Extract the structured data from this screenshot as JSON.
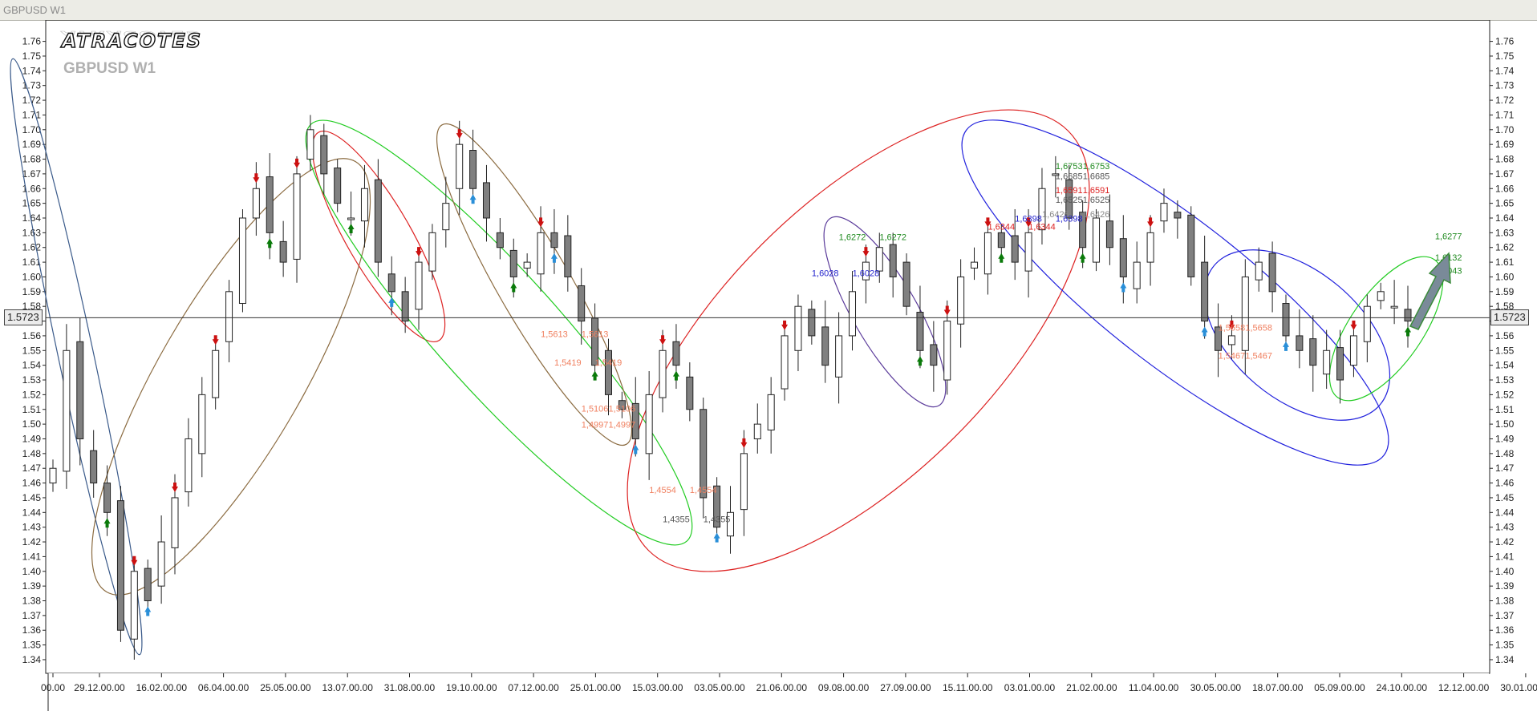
{
  "window": {
    "title": "GBPUSD W1"
  },
  "logo": {
    "text": "ATRACOTES"
  },
  "symbol_label": "GBPUSD W1",
  "current_price": "1.5723",
  "colors": {
    "bull_candle": "#ffffff",
    "bear_candle": "#808080",
    "up_arrow": "#2a8fd8",
    "down_arrow": "#cc1111",
    "green_ellipse": "#22cc22",
    "red_ellipse": "#dd2222",
    "blue_ellipse": "#2222dd",
    "brown_ellipse": "#8b6b40"
  },
  "chart_data": {
    "type": "candlestick",
    "ylim": [
      1.33,
      1.77
    ],
    "y_ticks": [
      "1.76",
      "1.75",
      "1.74",
      "1.73",
      "1.72",
      "1.71",
      "1.70",
      "1.69",
      "1.68",
      "1.67",
      "1.66",
      "1.65",
      "1.64",
      "1.63",
      "1.62",
      "1.61",
      "1.60",
      "1.59",
      "1.58",
      "1.57",
      "1.56",
      "1.55",
      "1.54",
      "1.53",
      "1.52",
      "1.51",
      "1.50",
      "1.49",
      "1.48",
      "1.47",
      "1.46",
      "1.45",
      "1.44",
      "1.43",
      "1.42",
      "1.41",
      "1.40",
      "1.39",
      "1.38",
      "1.37",
      "1.36",
      "1.35",
      "1.34"
    ],
    "x_ticks": [
      "00.00",
      "29.12.00.00",
      "16.02.00.00",
      "06.04.00.00",
      "25.05.00.00",
      "13.07.00.00",
      "31.08.00.00",
      "19.10.00.00",
      "07.12.00.00",
      "25.01.00.00",
      "15.03.00.00",
      "03.05.00.00",
      "21.06.00.00",
      "09.08.00.00",
      "27.09.00.00",
      "15.11.00.00",
      "03.01.00.00",
      "21.02.00.00",
      "11.04.00.00",
      "30.05.00.00",
      "18.07.00.00",
      "05.09.00.00",
      "24.10.00.00",
      "12.12.00.00",
      "30.01.00.00"
    ],
    "grid": false,
    "current_price": 1.5723,
    "path": [
      1.47,
      1.55,
      1.49,
      1.46,
      1.44,
      1.36,
      1.4,
      1.38,
      1.42,
      1.45,
      1.49,
      1.52,
      1.55,
      1.59,
      1.64,
      1.66,
      1.63,
      1.61,
      1.67,
      1.7,
      1.67,
      1.65,
      1.64,
      1.66,
      1.61,
      1.59,
      1.57,
      1.61,
      1.63,
      1.65,
      1.69,
      1.66,
      1.64,
      1.62,
      1.6,
      1.61,
      1.63,
      1.62,
      1.6,
      1.57,
      1.54,
      1.52,
      1.51,
      1.49,
      1.52,
      1.55,
      1.54,
      1.51,
      1.45,
      1.43,
      1.44,
      1.48,
      1.5,
      1.52,
      1.56,
      1.58,
      1.56,
      1.54,
      1.56,
      1.59,
      1.61,
      1.62,
      1.6,
      1.58,
      1.55,
      1.54,
      1.57,
      1.6,
      1.61,
      1.63,
      1.62,
      1.61,
      1.63,
      1.66,
      1.67,
      1.64,
      1.62,
      1.64,
      1.62,
      1.6,
      1.61,
      1.63,
      1.65,
      1.64,
      1.6,
      1.57,
      1.55,
      1.56,
      1.6,
      1.61,
      1.59,
      1.56,
      1.55,
      1.54,
      1.55,
      1.53,
      1.56,
      1.58,
      1.59,
      1.58,
      1.57
    ],
    "labels": [
      {
        "text": "1,6753",
        "x_idx": 75,
        "price": 1.6753,
        "color": "#1f8a1f"
      },
      {
        "text": "1,6753",
        "x_idx": 77,
        "price": 1.6753,
        "color": "#1f8a1f"
      },
      {
        "text": "1,6685",
        "x_idx": 75,
        "price": 1.6685,
        "color": "#555555"
      },
      {
        "text": "1,6685",
        "x_idx": 77,
        "price": 1.6685,
        "color": "#555555"
      },
      {
        "text": "1,6591",
        "x_idx": 75,
        "price": 1.6591,
        "color": "#dd2222"
      },
      {
        "text": "1,6591",
        "x_idx": 77,
        "price": 1.6591,
        "color": "#dd2222"
      },
      {
        "text": "1,6525",
        "x_idx": 75,
        "price": 1.6525,
        "color": "#555555"
      },
      {
        "text": "1,6525",
        "x_idx": 77,
        "price": 1.6525,
        "color": "#555555"
      },
      {
        "text": "1,6426",
        "x_idx": 74,
        "price": 1.6426,
        "color": "#888888"
      },
      {
        "text": "1,6426",
        "x_idx": 77,
        "price": 1.6426,
        "color": "#888888"
      },
      {
        "text": "1,6398",
        "x_idx": 72,
        "price": 1.6398,
        "color": "#2222cc"
      },
      {
        "text": "1,6398",
        "x_idx": 75,
        "price": 1.6398,
        "color": "#2222cc"
      },
      {
        "text": "1,6344",
        "x_idx": 70,
        "price": 1.6344,
        "color": "#dd2222"
      },
      {
        "text": "1,6344",
        "x_idx": 73,
        "price": 1.6344,
        "color": "#dd2222"
      },
      {
        "text": "1,6272",
        "x_idx": 59,
        "price": 1.6272,
        "color": "#1f8a1f"
      },
      {
        "text": "1,6272",
        "x_idx": 62,
        "price": 1.6272,
        "color": "#1f8a1f"
      },
      {
        "text": "1,6028",
        "x_idx": 57,
        "price": 1.6028,
        "color": "#2222cc"
      },
      {
        "text": "1,6028",
        "x_idx": 60,
        "price": 1.6028,
        "color": "#2222cc"
      },
      {
        "text": "1,5613",
        "x_idx": 37,
        "price": 1.5613,
        "color": "#f08060"
      },
      {
        "text": "1,5613",
        "x_idx": 40,
        "price": 1.5613,
        "color": "#f08060"
      },
      {
        "text": "1,5419",
        "x_idx": 38,
        "price": 1.5419,
        "color": "#f08060"
      },
      {
        "text": "1,5419",
        "x_idx": 41,
        "price": 1.5419,
        "color": "#f08060"
      },
      {
        "text": "1,5106",
        "x_idx": 40,
        "price": 1.5106,
        "color": "#f08060"
      },
      {
        "text": "1,5106",
        "x_idx": 42,
        "price": 1.5106,
        "color": "#f08060"
      },
      {
        "text": "1,4997",
        "x_idx": 40,
        "price": 1.4997,
        "color": "#f08060"
      },
      {
        "text": "1,4997",
        "x_idx": 42,
        "price": 1.4997,
        "color": "#f08060"
      },
      {
        "text": "1,4554",
        "x_idx": 45,
        "price": 1.4554,
        "color": "#f08060"
      },
      {
        "text": "1,4554",
        "x_idx": 48,
        "price": 1.4554,
        "color": "#f08060"
      },
      {
        "text": "1,4355",
        "x_idx": 46,
        "price": 1.4355,
        "color": "#555555"
      },
      {
        "text": "1,4355",
        "x_idx": 49,
        "price": 1.4355,
        "color": "#555555"
      },
      {
        "text": "1,5658",
        "x_idx": 87,
        "price": 1.5658,
        "color": "#f08060"
      },
      {
        "text": "1,5658",
        "x_idx": 89,
        "price": 1.5658,
        "color": "#f08060"
      },
      {
        "text": "1,5467",
        "x_idx": 87,
        "price": 1.5467,
        "color": "#f08060"
      },
      {
        "text": "1,5467",
        "x_idx": 89,
        "price": 1.5467,
        "color": "#f08060"
      },
      {
        "text": "1,6277",
        "x_idx": 103,
        "price": 1.6277,
        "color": "#1f8a1f"
      },
      {
        "text": "1,6132",
        "x_idx": 103,
        "price": 1.6132,
        "color": "#1f8a1f"
      },
      {
        "text": "1,6043",
        "x_idx": 103,
        "price": 1.6043,
        "color": "#1f8a1f"
      }
    ]
  }
}
